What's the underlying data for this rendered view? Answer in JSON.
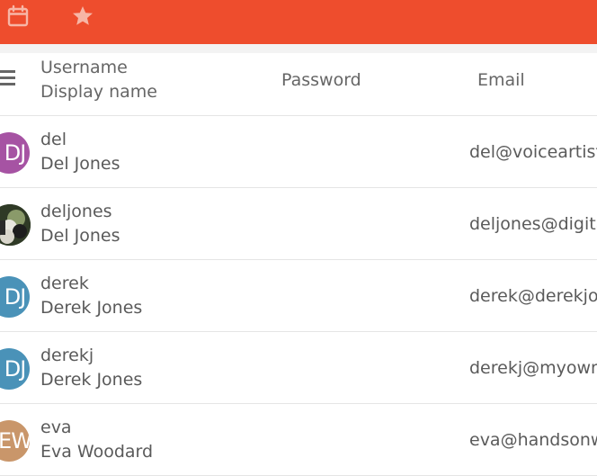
{
  "topbar": {
    "background": "#ee4d2d",
    "icons": [
      "calendar-icon",
      "star-icon"
    ]
  },
  "table": {
    "headers": {
      "username": "Username",
      "display_name": "Display name",
      "password": "Password",
      "email": "Email"
    },
    "rows": [
      {
        "initials": "DJ",
        "avatar_color": "#a653a3",
        "username": "del",
        "display_name": "Del Jones",
        "email": "del@voiceartist"
      },
      {
        "initials": "",
        "avatar_color": "#3a4a2e",
        "username": "deljones",
        "display_name": "Del Jones",
        "email": "deljones@digita"
      },
      {
        "initials": "DJ",
        "avatar_color": "#4a92b8",
        "username": "derek",
        "display_name": "Derek Jones",
        "email": "derek@derekjor"
      },
      {
        "initials": "DJ",
        "avatar_color": "#4a92b8",
        "username": "derekj",
        "display_name": "Derek Jones",
        "email": "derekj@myownk"
      },
      {
        "initials": "EW",
        "avatar_color": "#c9966a",
        "username": "eva",
        "display_name": "Eva Woodard",
        "email": "eva@handsonw"
      }
    ]
  }
}
